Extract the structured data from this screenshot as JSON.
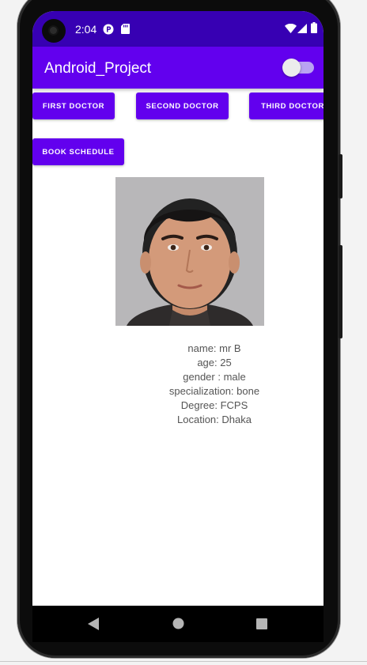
{
  "status_bar": {
    "time": "2:04",
    "icons": [
      "notification-p-icon",
      "sd-card-icon",
      "wifi-icon",
      "signal-icon",
      "battery-icon"
    ]
  },
  "app_bar": {
    "title": "Android_Project",
    "toggle_on": false
  },
  "buttons": {
    "first_doctor": "FIRST DOCTOR",
    "second_doctor": "SECOND DOCTOR",
    "third_doctor": "THIRD DOCTOR",
    "book_schedule": "BOOK SCHEDULE"
  },
  "doctor": {
    "name": "name: mr B",
    "age": "age: 25",
    "gender": "gender : male",
    "specialization": "specialization: bone",
    "degree": "Degree: FCPS",
    "location": "Location: Dhaka"
  },
  "colors": {
    "primary": "#6200ee",
    "primary_dark": "#3700b3"
  },
  "nav_bar": {
    "icons": [
      "back-icon",
      "home-icon",
      "recents-icon"
    ]
  }
}
